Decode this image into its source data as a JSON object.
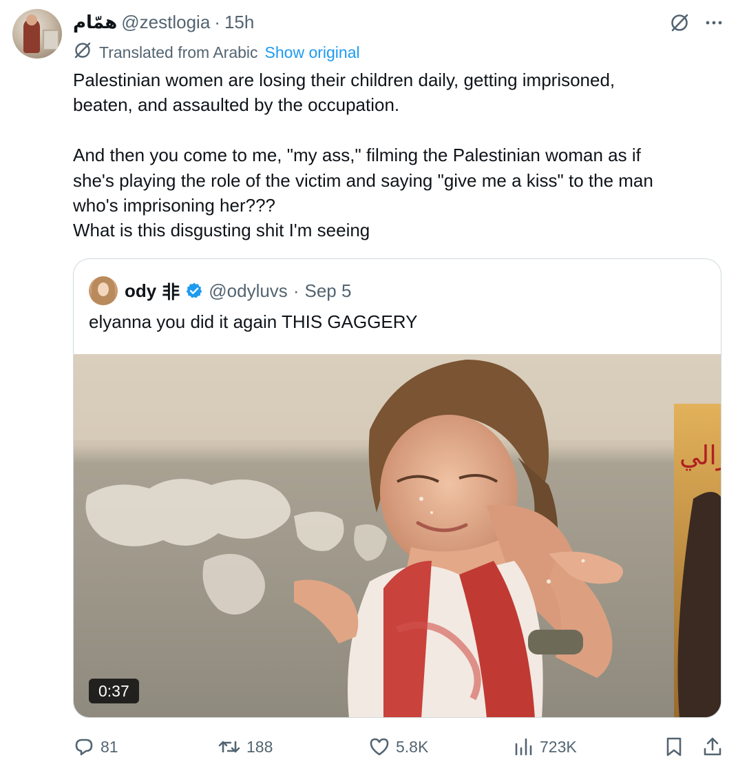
{
  "tweet": {
    "author": {
      "display_name": "همّام",
      "handle": "@zestlogia",
      "separator": "·",
      "time": "15h"
    },
    "translation": {
      "label": "Translated from Arabic",
      "show_original": "Show original"
    },
    "body": {
      "line1": "Palestinian women are losing their children daily, getting imprisoned,",
      "line2": "beaten, and assaulted by the occupation.",
      "line3": "And then you come to me, \"my ass,\" filming the Palestinian woman as if",
      "line4": "she's playing the role of the victim and saying \"give me a kiss\" to the man",
      "line5": "who's imprisoning her???",
      "line6": "What is this disgusting shit I'm seeing"
    },
    "quoted": {
      "display_name": "ody",
      "emblem": "非",
      "handle": "@odyluvs",
      "separator": "·",
      "date": "Sep 5",
      "text": "elyanna you did it again THIS GAGGERY",
      "video_duration": "0:37",
      "wall_text": "زالي"
    },
    "actions": {
      "replies": "81",
      "reposts": "188",
      "likes": "5.8K",
      "views": "723K"
    },
    "icons": [
      "grok-icon",
      "more-icon",
      "translate-icon",
      "verified-badge-icon",
      "reply-icon",
      "repost-icon",
      "like-icon",
      "views-icon",
      "bookmark-icon",
      "share-icon"
    ],
    "colors": {
      "text": "#0f1419",
      "secondary": "#536471",
      "link": "#1d9bf0",
      "border": "#cfd9de"
    }
  }
}
